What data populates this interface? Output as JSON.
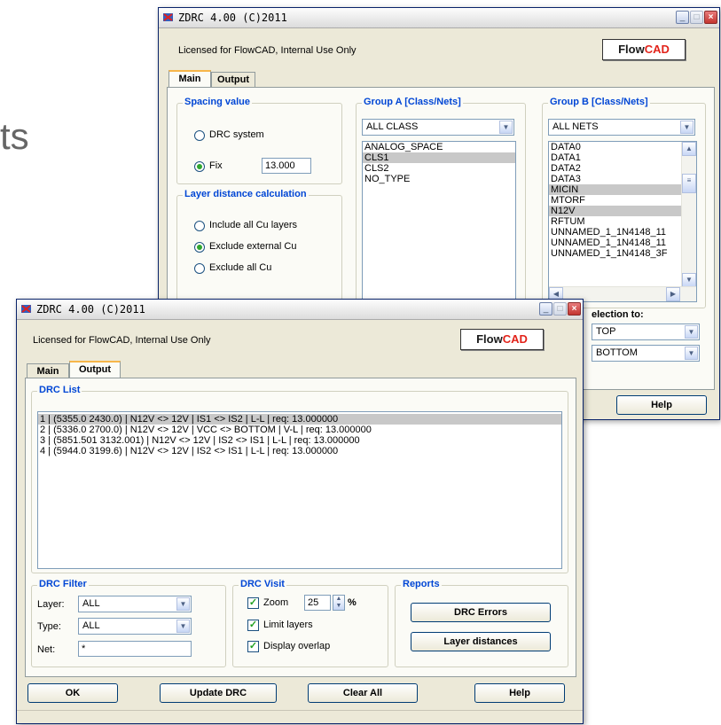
{
  "background": {
    "partial_text": "ts"
  },
  "window_back": {
    "title": "ZDRC 4.00 (C)2011",
    "license": "Licensed for FlowCAD, Internal Use Only",
    "logo": {
      "part1": "Flow",
      "part2": "CAD"
    },
    "tabs": [
      {
        "label": "Main",
        "selected": true
      },
      {
        "label": "Output",
        "selected": false
      }
    ],
    "spacing": {
      "title": "Spacing value",
      "drc_system_label": "DRC system",
      "fix_label": "Fix",
      "fix_value": "13.000",
      "selected": "Fix"
    },
    "layer_distance": {
      "title": "Layer distance calculation",
      "options": [
        "Include all Cu layers",
        "Exclude external Cu",
        "Exclude all Cu"
      ],
      "selected": "Exclude external Cu"
    },
    "group_a": {
      "title": "Group A [Class/Nets]",
      "combo_value": "ALL CLASS",
      "items": [
        "ANALOG_SPACE",
        "CLS1",
        "CLS2",
        "NO_TYPE"
      ],
      "selected": [
        "CLS1"
      ]
    },
    "group_b": {
      "title": "Group B [Class/Nets]",
      "combo_value": "ALL NETS",
      "items": [
        "DATA0",
        "DATA1",
        "DATA2",
        "DATA3",
        "MICIN",
        "MTORF",
        "N12V",
        "RFTUM",
        "UNNAMED_1_1N4148_11",
        "UNNAMED_1_1N4148_11",
        "UNNAMED_1_1N4148_3F"
      ],
      "selected": [
        "MICIN",
        "N12V"
      ]
    },
    "layer_selection": {
      "label": "election to:",
      "top_value": "TOP",
      "bottom_value": "BOTTOM"
    },
    "help_label": "Help"
  },
  "window_front": {
    "title": "ZDRC 4.00 (C)2011",
    "license": "Licensed for FlowCAD, Internal Use Only",
    "logo": {
      "part1": "Flow",
      "part2": "CAD"
    },
    "tabs": [
      {
        "label": "Main",
        "selected": false
      },
      {
        "label": "Output",
        "selected": true
      }
    ],
    "drc_list": {
      "title": "DRC List",
      "rows": [
        "1 | (5355.0 2430.0) | N12V <> 12V | IS1 <> IS2 | L-L | req: 13.000000",
        "2 | (5336.0 2700.0) | N12V <> 12V | VCC <> BOTTOM | V-L | req: 13.000000",
        "3 | (5851.501 3132.001) | N12V <> 12V | IS2 <> IS1 | L-L | req: 13.000000",
        "4 | (5944.0 3199.6) | N12V <> 12V | IS2 <> IS1 | L-L | req: 13.000000"
      ],
      "selected_index": 0
    },
    "drc_filter": {
      "title": "DRC Filter",
      "layer_label": "Layer:",
      "layer_value": "ALL",
      "type_label": "Type:",
      "type_value": "ALL",
      "net_label": "Net:",
      "net_value": "*"
    },
    "drc_visit": {
      "title": "DRC Visit",
      "zoom_label": "Zoom",
      "zoom_value": "25",
      "zoom_unit": "%",
      "zoom_checked": true,
      "limit_layers_label": "Limit layers",
      "limit_layers_checked": true,
      "display_overlap_label": "Display overlap",
      "display_overlap_checked": true
    },
    "reports": {
      "title": "Reports",
      "drc_errors_label": "DRC Errors",
      "layer_distances_label": "Layer distances"
    },
    "buttons": {
      "ok": "OK",
      "update_drc": "Update DRC",
      "clear_all": "Clear All",
      "help": "Help"
    }
  }
}
